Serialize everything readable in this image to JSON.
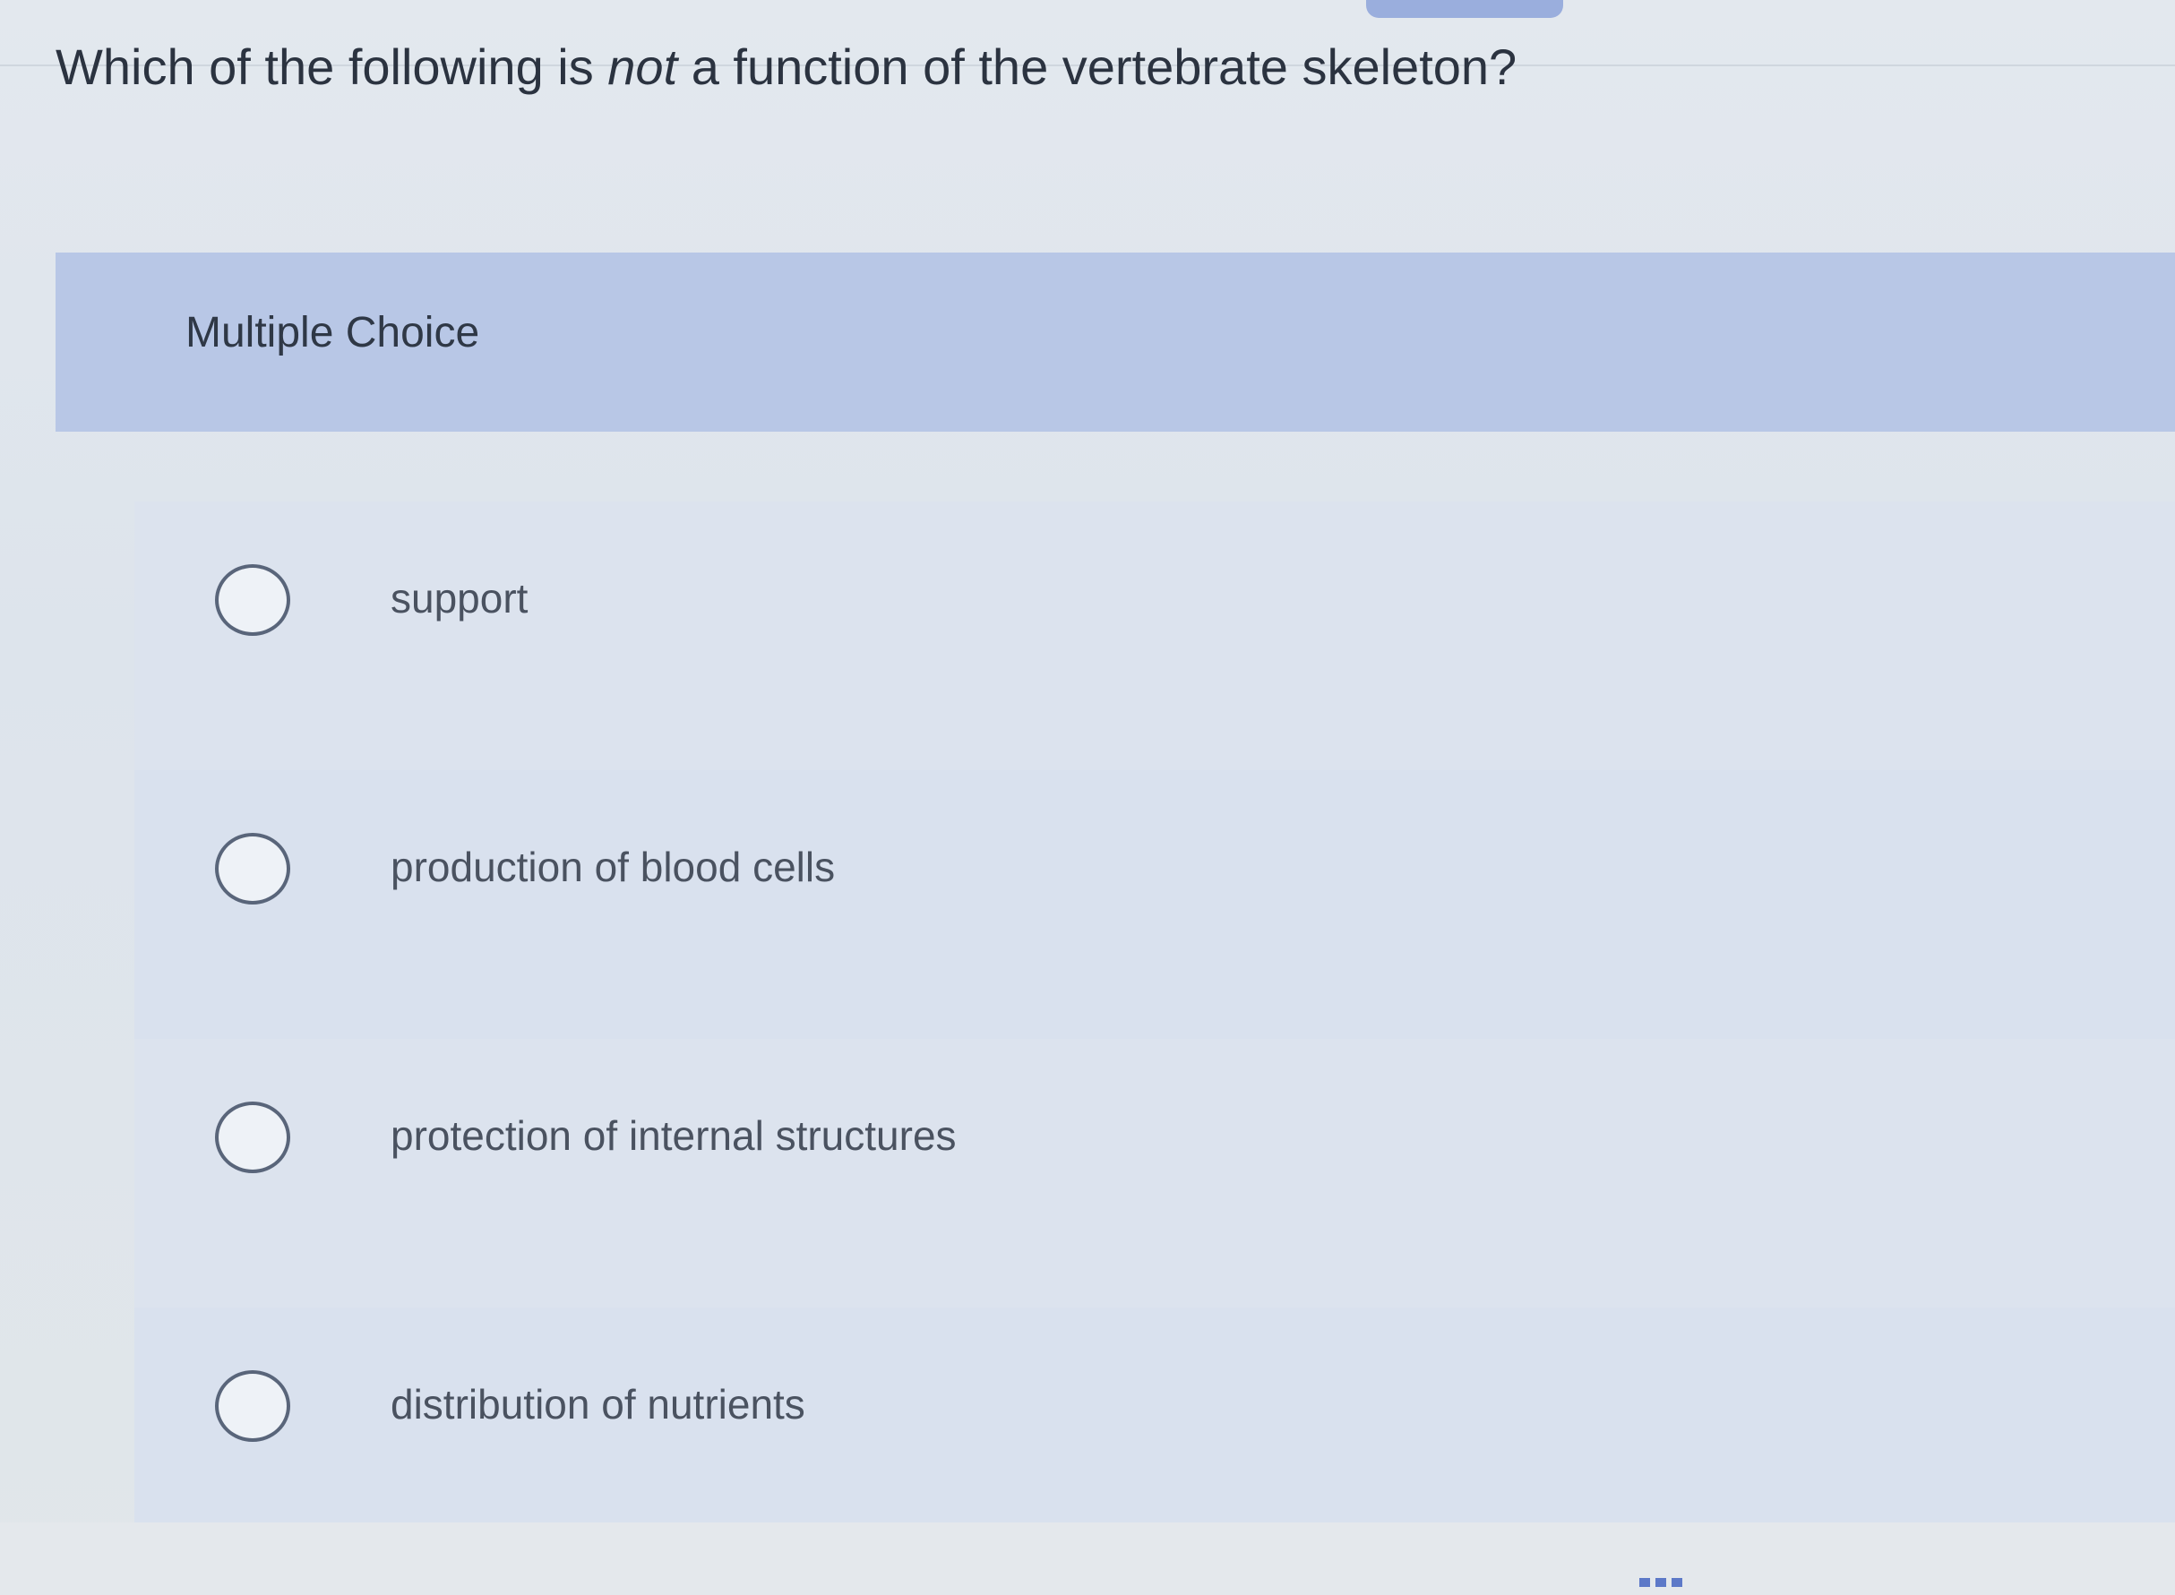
{
  "question": {
    "before": "Which of the following is ",
    "emphasis": "not",
    "after": " a function of the vertebrate skeleton?"
  },
  "section_label": "Multiple Choice",
  "options": [
    {
      "label": "support"
    },
    {
      "label": "production of blood cells"
    },
    {
      "label": "protection of internal structures"
    },
    {
      "label": "distribution of nutrients"
    }
  ]
}
